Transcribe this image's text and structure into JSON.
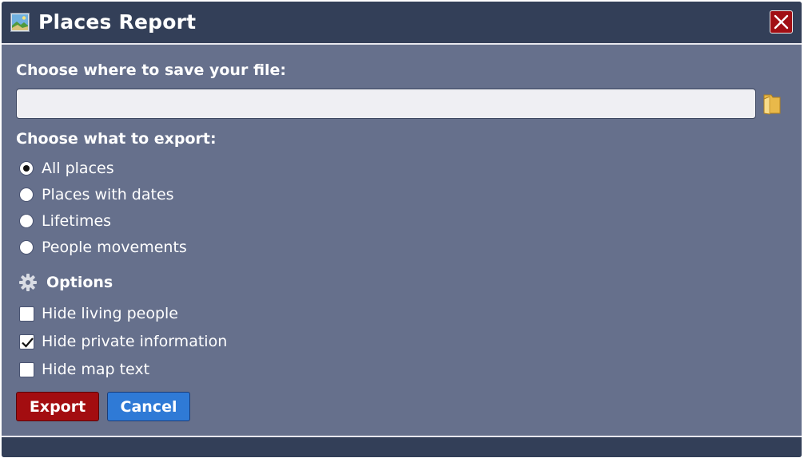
{
  "window": {
    "title": "Places Report",
    "icon": "map-picture-icon",
    "close_icon": "close-icon"
  },
  "file": {
    "label": "Choose where to save your file:",
    "value": "",
    "placeholder": "",
    "browse_icon": "folder-icon"
  },
  "export": {
    "label": "Choose what to export:",
    "choices": [
      {
        "label": "All places",
        "checked": true
      },
      {
        "label": "Places with dates",
        "checked": false
      },
      {
        "label": "Lifetimes",
        "checked": false
      },
      {
        "label": "People movements",
        "checked": false
      }
    ]
  },
  "options": {
    "heading": "Options",
    "icon": "gear-icon",
    "items": [
      {
        "label": "Hide living people",
        "checked": false
      },
      {
        "label": "Hide private information",
        "checked": true
      },
      {
        "label": "Hide map text",
        "checked": false
      }
    ]
  },
  "actions": {
    "export_label": "Export",
    "cancel_label": "Cancel"
  },
  "colors": {
    "titlebar": "#333f58",
    "body": "#66708c",
    "export_button": "#a30d10",
    "cancel_button": "#2f7ad6",
    "close_button": "#a10f14"
  }
}
